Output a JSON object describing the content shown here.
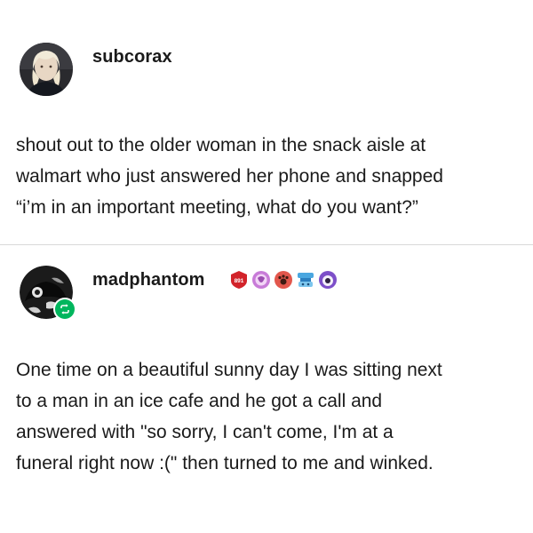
{
  "posts": [
    {
      "username": "subcorax",
      "avatar_icon": "user-portrait-icon",
      "body_lines": [
        "shout out to the older woman in the snack aisle at",
        "walmart who just answered her phone and snapped",
        "“i’m in an important meeting, what do you want?”"
      ]
    },
    {
      "username": "madphantom",
      "avatar_icon": "user-portrait-icon",
      "reblog_icon": "reblog-icon",
      "badges": [
        {
          "name": "level-badge",
          "label": "891",
          "color": "#d2232a"
        },
        {
          "name": "pink-badge-icon",
          "color": "#c87bd8"
        },
        {
          "name": "paw-badge-icon",
          "color": "#e2574c"
        },
        {
          "name": "blue-badge-icon",
          "color": "#4aa7e0"
        },
        {
          "name": "purple-badge-icon",
          "color": "#7d4fc9"
        }
      ],
      "body_lines": [
        "One time on a beautiful sunny day I was sitting next",
        "to a man in an ice cafe and he got a call and",
        "answered with \"so sorry, I can't come, I'm at a",
        "funeral right now :(\" then turned to me and winked."
      ]
    }
  ],
  "colors": {
    "reblog_green": "#00b65d",
    "divider": "#d8d8d8",
    "text": "#1a1a1a"
  }
}
